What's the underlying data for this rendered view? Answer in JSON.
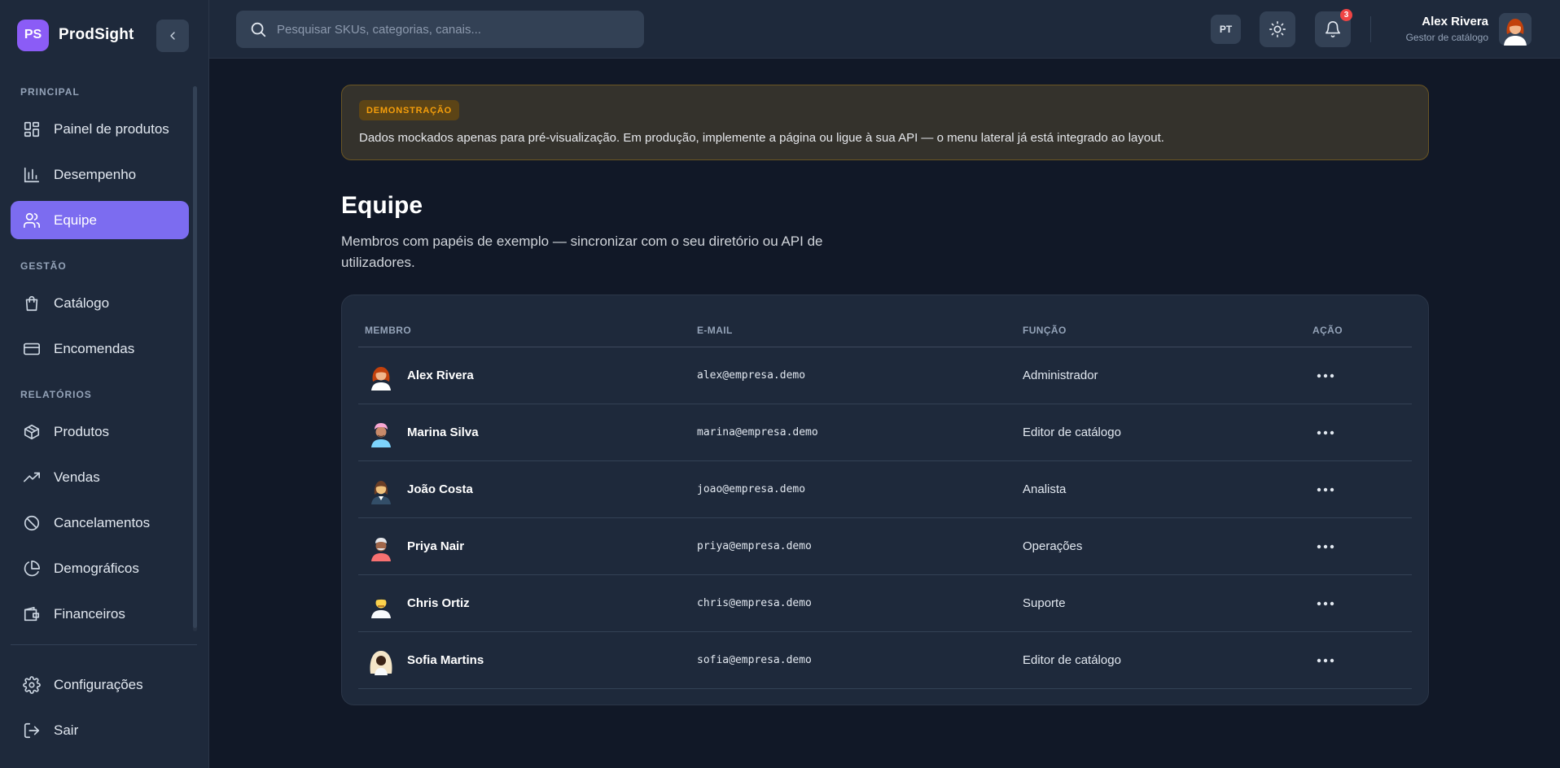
{
  "brand": {
    "logo_text": "PS",
    "name": "ProdSight"
  },
  "sidebar": {
    "sections": [
      {
        "label": "PRINCIPAL"
      },
      {
        "label": "GESTÃO"
      },
      {
        "label": "RELATÓRIOS"
      }
    ],
    "items": [
      {
        "label": "Painel de produtos",
        "icon": "dashboard-icon"
      },
      {
        "label": "Desempenho",
        "icon": "bar-chart-icon"
      },
      {
        "label": "Equipe",
        "icon": "users-icon",
        "active": true
      },
      {
        "label": "Catálogo",
        "icon": "shopping-bag-icon"
      },
      {
        "label": "Encomendas",
        "icon": "credit-card-icon"
      },
      {
        "label": "Produtos",
        "icon": "package-icon"
      },
      {
        "label": "Vendas",
        "icon": "trending-up-icon"
      },
      {
        "label": "Cancelamentos",
        "icon": "ban-icon"
      },
      {
        "label": "Demográficos",
        "icon": "pie-chart-icon"
      },
      {
        "label": "Financeiros",
        "icon": "wallet-icon"
      }
    ],
    "footer": [
      {
        "label": "Configurações",
        "icon": "gear-icon"
      },
      {
        "label": "Sair",
        "icon": "logout-icon"
      }
    ]
  },
  "topbar": {
    "search_placeholder": "Pesquisar SKUs, categorias, canais...",
    "language": "PT",
    "notification_count": "3",
    "user_name": "Alex Rivera",
    "user_role": "Gestor de catálogo"
  },
  "notice": {
    "tag": "DEMONSTRAÇÃO",
    "text": "Dados mockados apenas para pré-visualização. Em produção, implemente a página ou ligue à sua API — o menu lateral já está integrado ao layout."
  },
  "page": {
    "title": "Equipe",
    "subtitle": "Membros com papéis de exemplo — sincronizar com o seu diretório ou API de utilizadores."
  },
  "table": {
    "headers": {
      "member": "MEMBRO",
      "email": "E-MAIL",
      "role": "FUNÇÃO",
      "action": "AÇÃO"
    },
    "rows": [
      {
        "name": "Alex Rivera",
        "email": "alex@empresa.demo",
        "role": "Administrador"
      },
      {
        "name": "Marina Silva",
        "email": "marina@empresa.demo",
        "role": "Editor de catálogo"
      },
      {
        "name": "João Costa",
        "email": "joao@empresa.demo",
        "role": "Analista"
      },
      {
        "name": "Priya Nair",
        "email": "priya@empresa.demo",
        "role": "Operações"
      },
      {
        "name": "Chris Ortiz",
        "email": "chris@empresa.demo",
        "role": "Suporte"
      },
      {
        "name": "Sofia Martins",
        "email": "sofia@empresa.demo",
        "role": "Editor de catálogo"
      }
    ]
  },
  "colors": {
    "accent": "#7c6cf0",
    "background": "#111827",
    "panel": "#1e293b",
    "warning": "#f59e0b",
    "danger": "#ef4444"
  }
}
